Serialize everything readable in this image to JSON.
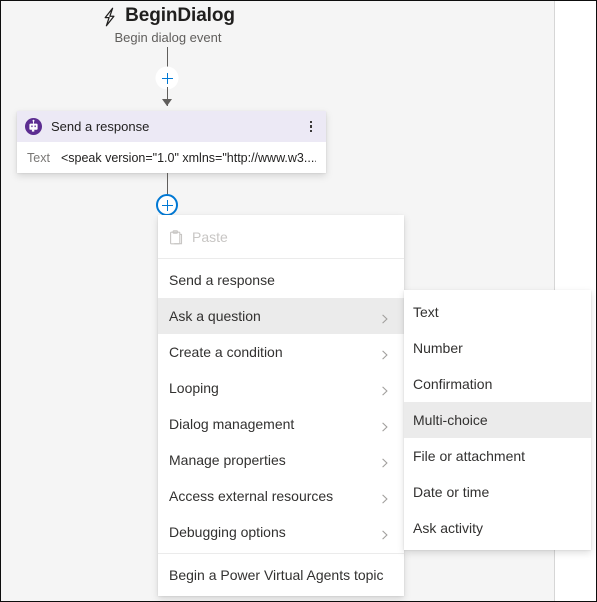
{
  "trigger": {
    "icon": "lightning-bolt-icon",
    "title": "BeginDialog",
    "subtitle": "Begin dialog event"
  },
  "node": {
    "icon": "bot-response-icon",
    "title": "Send a response",
    "more_icon": "kebab-menu-icon",
    "field_label": "Text",
    "field_value": "<speak version=\"1.0\" xmlns=\"http://www.w3...."
  },
  "connectors": {
    "add_node_top_icon": "plus-icon",
    "add_node_bottom_icon": "plus-icon"
  },
  "menu": {
    "items": [
      {
        "label": "Paste",
        "icon": "clipboard-icon",
        "disabled": true,
        "submenu": false,
        "selected": false
      },
      {
        "label": "Send a response",
        "icon": null,
        "disabled": false,
        "submenu": false,
        "selected": false
      },
      {
        "label": "Ask a question",
        "icon": null,
        "disabled": false,
        "submenu": true,
        "selected": true
      },
      {
        "label": "Create a condition",
        "icon": null,
        "disabled": false,
        "submenu": true,
        "selected": false
      },
      {
        "label": "Looping",
        "icon": null,
        "disabled": false,
        "submenu": true,
        "selected": false
      },
      {
        "label": "Dialog management",
        "icon": null,
        "disabled": false,
        "submenu": true,
        "selected": false
      },
      {
        "label": "Manage properties",
        "icon": null,
        "disabled": false,
        "submenu": true,
        "selected": false
      },
      {
        "label": "Access external resources",
        "icon": null,
        "disabled": false,
        "submenu": true,
        "selected": false
      },
      {
        "label": "Debugging options",
        "icon": null,
        "disabled": false,
        "submenu": true,
        "selected": false
      },
      {
        "label": "Begin a Power Virtual Agents topic",
        "icon": null,
        "disabled": false,
        "submenu": false,
        "selected": false
      }
    ]
  },
  "submenu": {
    "items": [
      {
        "label": "Text",
        "selected": false
      },
      {
        "label": "Number",
        "selected": false
      },
      {
        "label": "Confirmation",
        "selected": false
      },
      {
        "label": "Multi-choice",
        "selected": true
      },
      {
        "label": "File or attachment",
        "selected": false
      },
      {
        "label": "Date or time",
        "selected": false
      },
      {
        "label": "Ask activity",
        "selected": false
      }
    ]
  },
  "colors": {
    "canvas_background": "#f5f5f5",
    "node_header": "#ece9f5",
    "node_icon": "#5c2d91",
    "accent": "#0078d4",
    "menu_hover": "#ebebeb"
  }
}
